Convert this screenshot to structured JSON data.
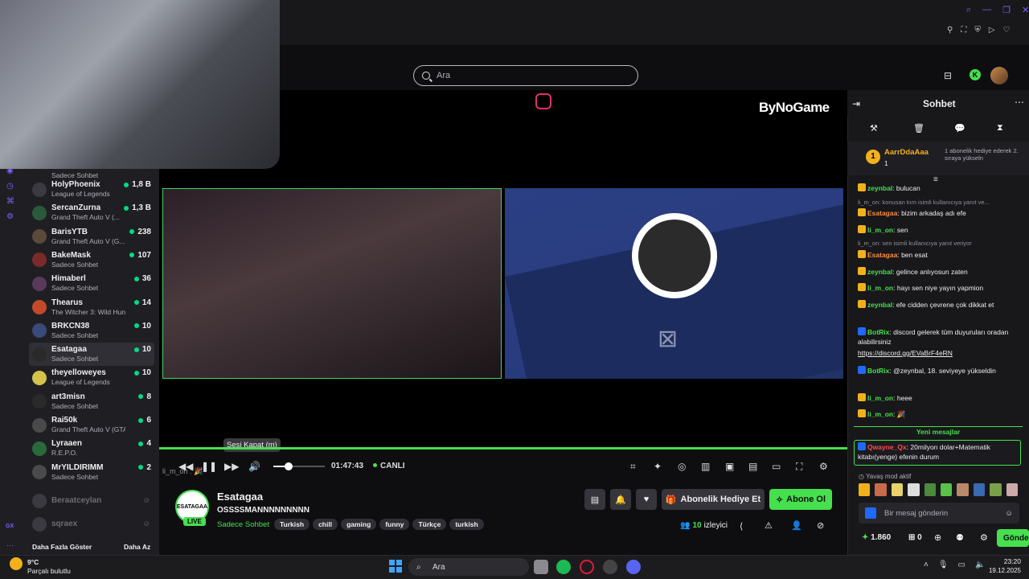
{
  "browser": {
    "search_placeholder": "Ara"
  },
  "brand": {
    "logo_text": "ByNoGame",
    "accent": "#46e04f"
  },
  "sidebar": {
    "top_label": "Sadece Sohbet",
    "channels": [
      {
        "name": "HolyPhoenix",
        "game": "League of Legends",
        "viewers": "1,8 B"
      },
      {
        "name": "SercanZurna",
        "game": "Grand Theft Auto V (...",
        "viewers": "1,3 B"
      },
      {
        "name": "BarisYTB",
        "game": "Grand Theft Auto V (G...",
        "viewers": "238"
      },
      {
        "name": "BakeMask",
        "game": "Sadece Sohbet",
        "viewers": "107"
      },
      {
        "name": "Himaberl",
        "game": "Sadece Sohbet",
        "viewers": "36"
      },
      {
        "name": "Thearus",
        "game": "The Witcher 3: Wild Hunt",
        "viewers": "14"
      },
      {
        "name": "BRKCN38",
        "game": "Sadece Sohbet",
        "viewers": "10"
      },
      {
        "name": "Esatagaa",
        "game": "Sadece Sohbet",
        "viewers": "10"
      },
      {
        "name": "theyelloweyes",
        "game": "League of Legends",
        "viewers": "10"
      },
      {
        "name": "art3misn",
        "game": "Sadece Sohbet",
        "viewers": "8"
      },
      {
        "name": "Rai50k",
        "game": "Grand Theft Auto V (GTA)",
        "viewers": "6"
      },
      {
        "name": "Lyraaen",
        "game": "R.E.P.O.",
        "viewers": "4"
      },
      {
        "name": "MrYILDIRIMM",
        "game": "Sadece Sohbet",
        "viewers": "2"
      }
    ],
    "offline": [
      "Beraatceylan",
      "sqraex"
    ],
    "show_more": "Daha Fazla Göster",
    "show_less": "Daha Az"
  },
  "player": {
    "tooltip": "Sesi Kapat (m)",
    "time": "01:47:43",
    "live_label": "CANLI",
    "overlay_text": "li_m_on : 🎉",
    "progress": 1.0
  },
  "stream": {
    "channel": "Esatagaa",
    "title": "OSSSSMANNNNNNNNN",
    "category": "Sadece Sohbet",
    "avatar_text": "ESATAGAA",
    "live_badge": "LIVE",
    "tags": [
      "Turkish",
      "chill",
      "gaming",
      "funny",
      "Türkçe",
      "turkish"
    ],
    "gift_button": "Abonelik Hediye Et",
    "subscribe_button": "Abone Ol",
    "viewers_count": "10",
    "viewers_label": "izleyici"
  },
  "chat": {
    "title": "Sohbet",
    "sub_gift": {
      "rank": "1",
      "user": "AarrDdaAaa",
      "count": "1",
      "note": "1 abonelik hediye ederek 2. sıraya yükseln"
    },
    "messages": [
      {
        "type": "msg",
        "user": "zeynbal",
        "color": "#46e04f",
        "text": "bulucan"
      },
      {
        "type": "reply",
        "text": "li_m_on: konusan kım isimli kullanıcıya yanıt ve..."
      },
      {
        "type": "msg",
        "user": "Esatagaa",
        "color": "#ff8c3a",
        "text": "bizim arkadaş adı efe"
      },
      {
        "type": "msg",
        "user": "li_m_on",
        "color": "#46e04f",
        "text": "sen"
      },
      {
        "type": "reply",
        "text": "li_m_on: sen isimli kullanıcıya yanıt veriyor"
      },
      {
        "type": "msg",
        "user": "Esatagaa",
        "color": "#ff8c3a",
        "text": "ben esat"
      },
      {
        "type": "msg",
        "user": "zeynbal",
        "color": "#46e04f",
        "text": "gelince anlıyosun zaten"
      },
      {
        "type": "msg",
        "user": "li_m_on",
        "color": "#46e04f",
        "text": "hayı sen niye yayın yapmion"
      },
      {
        "type": "msg",
        "user": "zeynbal",
        "color": "#46e04f",
        "text": "efe cidden çevrene çok dikkat et"
      },
      {
        "type": "msg",
        "user": "BotRix",
        "color": "#46e04f",
        "text": "discord gelerek tüm duyuruları oradan alabilirsiniz"
      },
      {
        "type": "link",
        "text": "https://discord.gg/EVaBrF4eRN"
      },
      {
        "type": "msg",
        "user": "BotRix",
        "color": "#46e04f",
        "text": "@zeynbal, 18. seviyeye yükseldin"
      },
      {
        "type": "msg",
        "user": "li_m_on",
        "color": "#46e04f",
        "text": "heee"
      },
      {
        "type": "msg",
        "user": "li_m_on",
        "color": "#46e04f",
        "text": "🎉"
      }
    ],
    "new_messages": "Yeni mesajlar",
    "highlighted": {
      "user": "Qwayne_Qx",
      "text": "20milyon dolar+Matematik kitabı(yenge) efenin durum"
    },
    "slow_mode": "Yavaş mod aktif",
    "input_placeholder": "Bir mesaj gönderin",
    "points": "1.860",
    "zero": "0",
    "send_button": "Gönder"
  },
  "taskbar": {
    "weather_temp": "9°C",
    "weather_desc": "Parçalı bulutlu",
    "search": "Ara",
    "time": "23:20",
    "date": "19.12.2025",
    "side_gx": "GX"
  }
}
